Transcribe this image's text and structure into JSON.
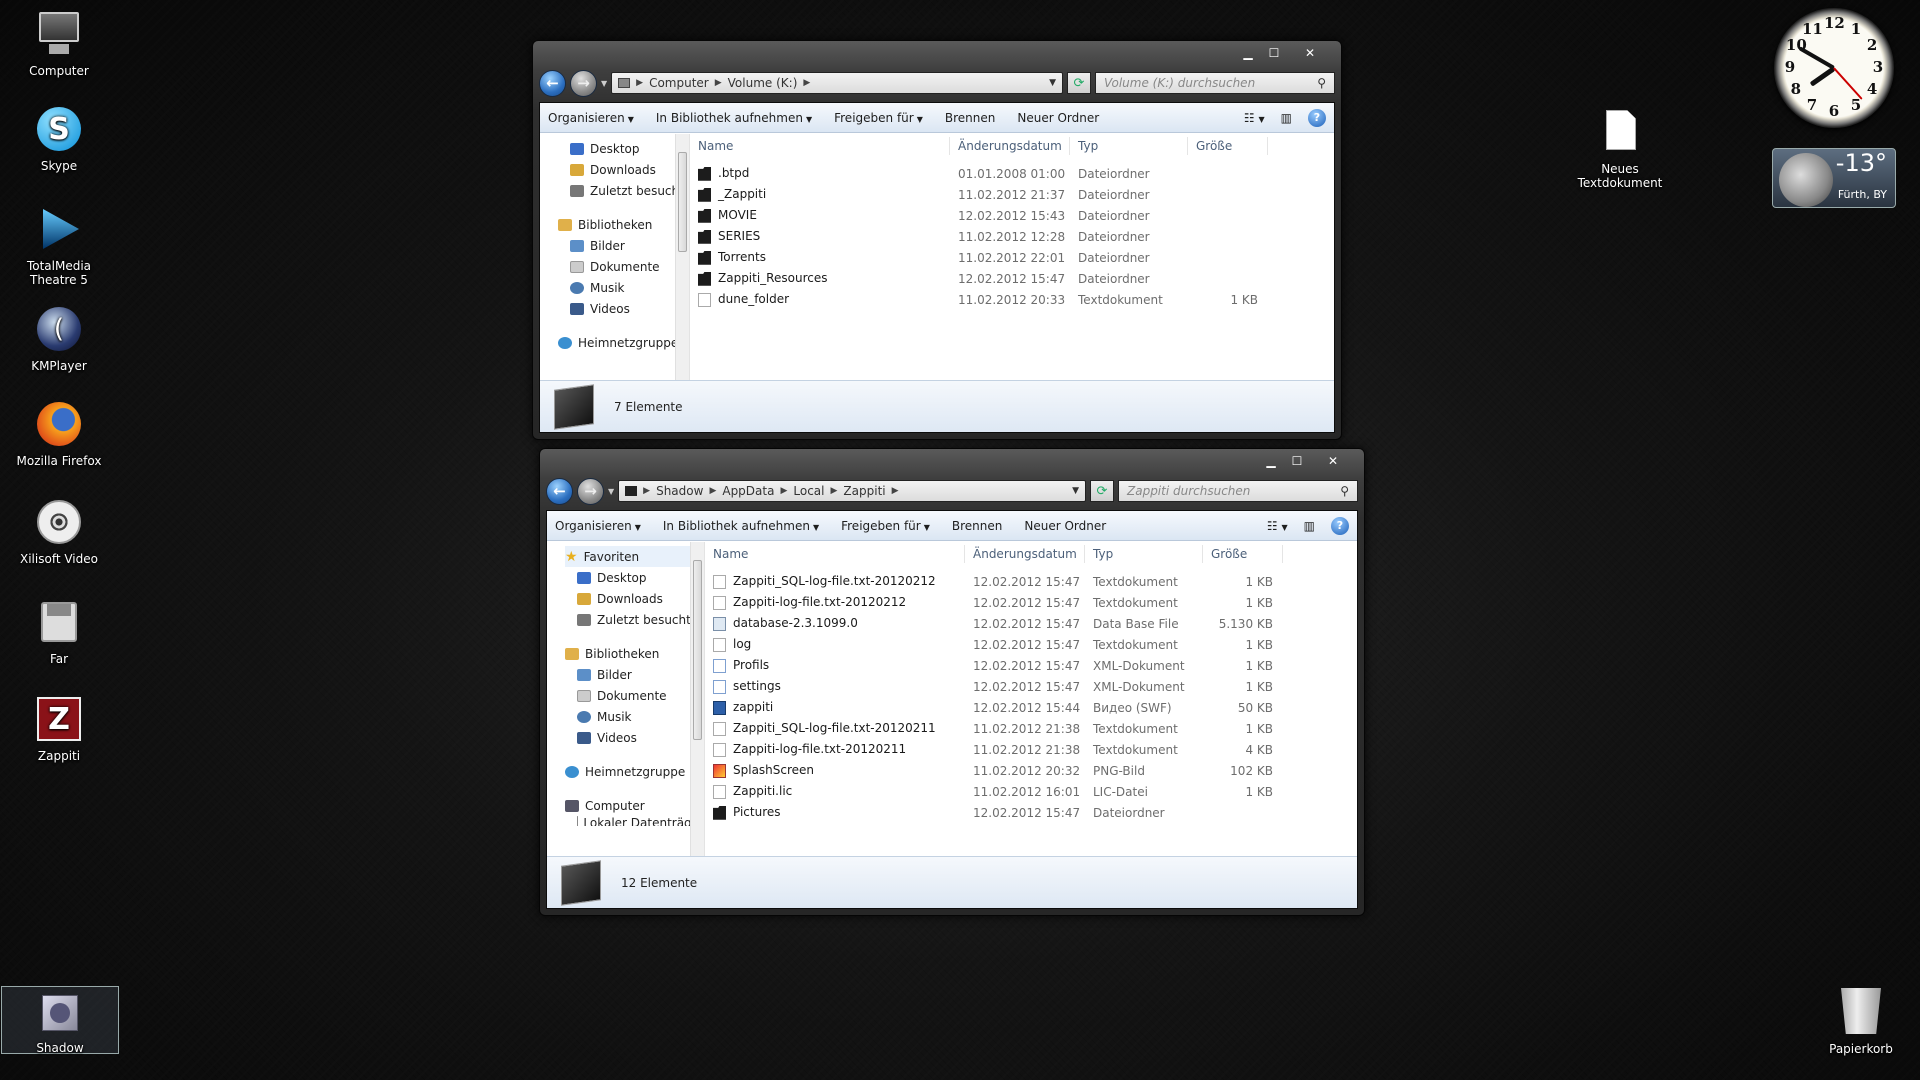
{
  "desktop": {
    "icons": [
      {
        "label": "Computer",
        "icon": "computer-icon"
      },
      {
        "label": "Skype",
        "icon": "skype-icon"
      },
      {
        "label": "TotalMedia Theatre 5",
        "icon": "totalmedia-icon"
      },
      {
        "label": "KMPlayer",
        "icon": "kmplayer-icon"
      },
      {
        "label": "Mozilla Firefox",
        "icon": "firefox-icon"
      },
      {
        "label": "Xilisoft Video",
        "icon": "film-reel-icon"
      },
      {
        "label": "Far",
        "icon": "floppy-icon"
      },
      {
        "label": "Zappiti",
        "icon": "zappiti-icon"
      },
      {
        "label": "Shadow",
        "icon": "user-folder-icon"
      }
    ],
    "right_icons": {
      "new_text_document": "Neues Textdokument",
      "recycle_bin": "Papierkorb"
    }
  },
  "gadgets": {
    "clock": {
      "numbers": [
        "12",
        "1",
        "2",
        "3",
        "4",
        "5",
        "6",
        "7",
        "8",
        "9",
        "10",
        "11"
      ],
      "hour": 7,
      "minute": 50,
      "second": 23
    },
    "weather": {
      "temperature": "-13°",
      "location": "Fürth, BY"
    }
  },
  "window1": {
    "breadcrumb": [
      "Computer",
      "Volume (K:)"
    ],
    "search_placeholder": "Volume (K:) durchsuchen",
    "toolbar": {
      "organize": "Organisieren",
      "library": "In Bibliothek aufnehmen",
      "share": "Freigeben für",
      "burn": "Brennen",
      "new_folder": "Neuer Ordner"
    },
    "nav": {
      "favorites_items": [
        "Desktop",
        "Downloads",
        "Zuletzt besucht"
      ],
      "libraries": "Bibliotheken",
      "library_items": [
        "Bilder",
        "Dokumente",
        "Musik",
        "Videos"
      ],
      "homegroup": "Heimnetzgruppe"
    },
    "columns": {
      "name": "Name",
      "date": "Änderungsdatum",
      "type": "Typ",
      "size": "Größe"
    },
    "files": [
      {
        "name": ".btpd",
        "date": "01.01.2008 01:00",
        "type": "Dateiordner",
        "size": "",
        "icon": "folder"
      },
      {
        "name": "_Zappiti",
        "date": "11.02.2012 21:37",
        "type": "Dateiordner",
        "size": "",
        "icon": "folder"
      },
      {
        "name": "MOVIE",
        "date": "12.02.2012 15:43",
        "type": "Dateiordner",
        "size": "",
        "icon": "folder"
      },
      {
        "name": "SERIES",
        "date": "11.02.2012 12:28",
        "type": "Dateiordner",
        "size": "",
        "icon": "folder"
      },
      {
        "name": "Torrents",
        "date": "11.02.2012 22:01",
        "type": "Dateiordner",
        "size": "",
        "icon": "folder"
      },
      {
        "name": "Zappiti_Resources",
        "date": "12.02.2012 15:47",
        "type": "Dateiordner",
        "size": "",
        "icon": "folder"
      },
      {
        "name": "dune_folder",
        "date": "11.02.2012 20:33",
        "type": "Textdokument",
        "size": "1 KB",
        "icon": "txt"
      }
    ],
    "status": "7 Elemente"
  },
  "window2": {
    "breadcrumb": [
      "Shadow",
      "AppData",
      "Local",
      "Zappiti"
    ],
    "search_placeholder": "Zappiti durchsuchen",
    "toolbar": {
      "organize": "Organisieren",
      "library": "In Bibliothek aufnehmen",
      "share": "Freigeben für",
      "burn": "Brennen",
      "new_folder": "Neuer Ordner"
    },
    "nav": {
      "favorites": "Favoriten",
      "favorites_items": [
        "Desktop",
        "Downloads",
        "Zuletzt besucht"
      ],
      "libraries": "Bibliotheken",
      "library_items": [
        "Bilder",
        "Dokumente",
        "Musik",
        "Videos"
      ],
      "homegroup": "Heimnetzgruppe",
      "computer": "Computer",
      "partial": "Lokaler Datenträger"
    },
    "columns": {
      "name": "Name",
      "date": "Änderungsdatum",
      "type": "Typ",
      "size": "Größe"
    },
    "files": [
      {
        "name": "Zappiti_SQL-log-file.txt-20120212",
        "date": "12.02.2012 15:47",
        "type": "Textdokument",
        "size": "1 KB",
        "icon": "txt"
      },
      {
        "name": "Zappiti-log-file.txt-20120212",
        "date": "12.02.2012 15:47",
        "type": "Textdokument",
        "size": "1 KB",
        "icon": "txt"
      },
      {
        "name": "database-2.3.1099.0",
        "date": "12.02.2012 15:47",
        "type": "Data Base File",
        "size": "5.130 KB",
        "icon": "db"
      },
      {
        "name": "log",
        "date": "12.02.2012 15:47",
        "type": "Textdokument",
        "size": "1 KB",
        "icon": "txt"
      },
      {
        "name": "Profils",
        "date": "12.02.2012 15:47",
        "type": "XML-Dokument",
        "size": "1 KB",
        "icon": "xml"
      },
      {
        "name": "settings",
        "date": "12.02.2012 15:47",
        "type": "XML-Dokument",
        "size": "1 KB",
        "icon": "xml"
      },
      {
        "name": "zappiti",
        "date": "12.02.2012 15:44",
        "type": "Видео (SWF)",
        "size": "50 KB",
        "icon": "swf"
      },
      {
        "name": "Zappiti_SQL-log-file.txt-20120211",
        "date": "11.02.2012 21:38",
        "type": "Textdokument",
        "size": "1 KB",
        "icon": "txt"
      },
      {
        "name": "Zappiti-log-file.txt-20120211",
        "date": "11.02.2012 21:38",
        "type": "Textdokument",
        "size": "4 KB",
        "icon": "txt"
      },
      {
        "name": "SplashScreen",
        "date": "11.02.2012 20:32",
        "type": "PNG-Bild",
        "size": "102 KB",
        "icon": "png"
      },
      {
        "name": "Zappiti.lic",
        "date": "11.02.2012 16:01",
        "type": "LIC-Datei",
        "size": "1 KB",
        "icon": "txt"
      },
      {
        "name": "Pictures",
        "date": "12.02.2012 15:47",
        "type": "Dateiordner",
        "size": "",
        "icon": "folder"
      }
    ],
    "status": "12 Elemente"
  }
}
